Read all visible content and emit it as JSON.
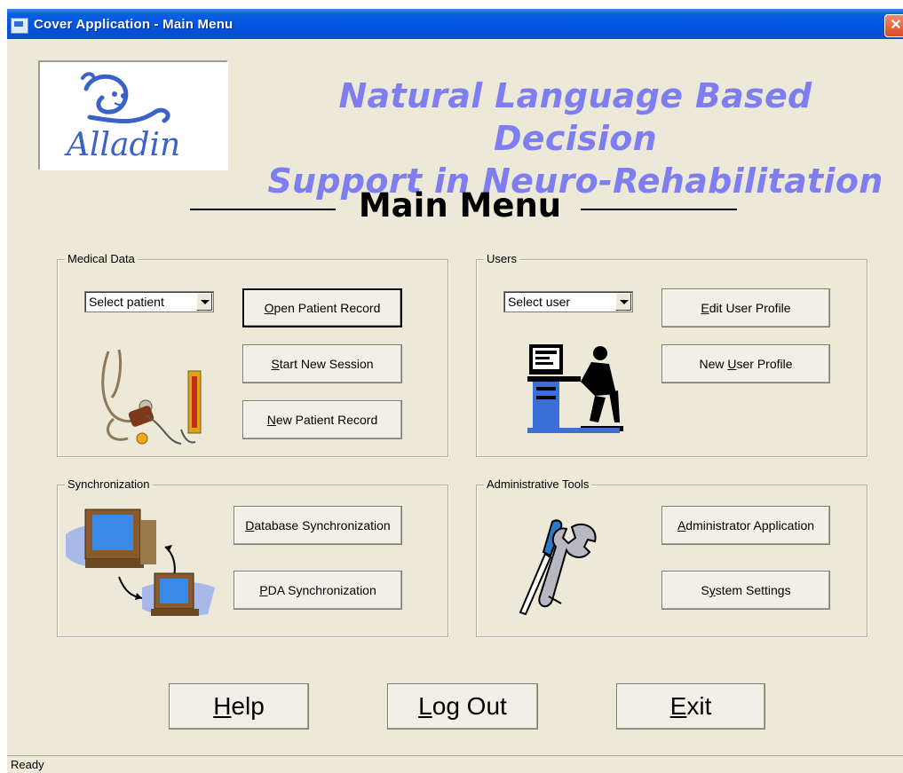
{
  "window": {
    "title": "Cover Application - Main Menu",
    "close_glyph": "✕"
  },
  "header": {
    "logo_text": "Alladin",
    "headline_line1": "Natural Language Based Decision",
    "headline_line2": "Support in Neuro-Rehabilitation",
    "main_menu_title": "Main Menu"
  },
  "medical_data": {
    "label": "Medical Data",
    "select_value": "Select patient",
    "open_record": {
      "mnemonic": "O",
      "rest": "pen Patient Record"
    },
    "start_session": {
      "mnemonic": "S",
      "rest": "tart New Session"
    },
    "new_record": {
      "mnemonic": "N",
      "rest": "ew Patient Record"
    },
    "image_icon": "stethoscope-sphygmomanometer-icon"
  },
  "users": {
    "label": "Users",
    "select_value": "Select user",
    "edit_profile": {
      "mnemonic": "E",
      "rest": "dit User Profile"
    },
    "new_profile": {
      "pre": "New ",
      "mnemonic": "U",
      "rest": "ser Profile"
    },
    "image_icon": "user-at-computer-icon"
  },
  "synchronization": {
    "label": "Synchronization",
    "database_sync": {
      "mnemonic": "D",
      "rest": "atabase Synchronization"
    },
    "pda_sync": {
      "mnemonic": "P",
      "rest": "DA Synchronization"
    },
    "image_icon": "computers-sync-icon"
  },
  "admin_tools": {
    "label": "Administrative Tools",
    "admin_app": {
      "mnemonic": "A",
      "rest": "dministrator Application"
    },
    "system_settings": {
      "pre": "S",
      "mnemonic": "y",
      "rest": "stem Settings"
    },
    "image_icon": "screwdriver-wrench-icon"
  },
  "footer": {
    "help": {
      "mnemonic": "H",
      "rest": "elp"
    },
    "logout": {
      "mnemonic": "L",
      "rest": "og Out"
    },
    "exit": {
      "mnemonic": "E",
      "rest": "xit"
    }
  },
  "status": {
    "text": "Ready"
  },
  "colors": {
    "titlebar": "#0054e3",
    "face": "#ece9d8",
    "headline": "#7e7ef0"
  }
}
